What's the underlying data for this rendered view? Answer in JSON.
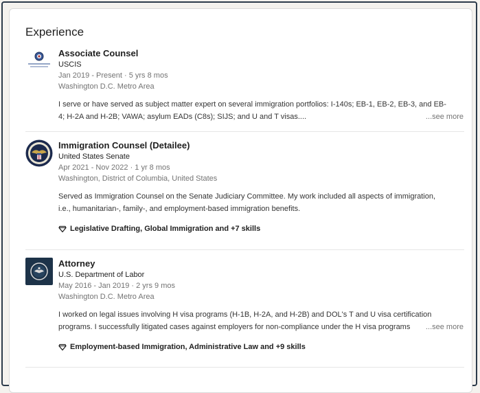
{
  "section": {
    "title": "Experience"
  },
  "experiences": [
    {
      "title": "Associate Counsel",
      "organization": "USCIS",
      "dates": "Jan 2019 - Present · 5 yrs 8 mos",
      "location": "Washington D.C. Metro Area",
      "description_lines": [
        "I serve or have served as subject matter expert on several immigration portfolios: I-140s; EB-1, EB-2, EB-3, and EB-",
        "4; H-2A and H-2B; VAWA; asylum EADs (C8s); SIJS; and U and T visas...."
      ],
      "see_more": "...see more",
      "logo_icon": "uscis-seal-icon"
    },
    {
      "title": "Immigration Counsel (Detailee)",
      "organization": "United States Senate",
      "dates": "Apr 2021 - Nov 2022 · 1 yr 8 mos",
      "location": "Washington, District of Columbia, United States",
      "description_lines": [
        "Served as Immigration Counsel on the Senate Judiciary Committee. My work included all aspects of immigration,",
        "i.e., humanitarian-, family-, and employment-based immigration benefits."
      ],
      "skills": "Legislative Drafting, Global Immigration and +7 skills",
      "logo_icon": "senate-seal-icon"
    },
    {
      "title": "Attorney",
      "organization": "U.S. Department of Labor",
      "dates": "May 2016 - Jan 2019 · 2 yrs 9 mos",
      "location": "Washington D.C. Metro Area",
      "description_lines": [
        "I worked on legal issues involving H visa programs (H-1B, H-2A, and H-2B) and DOL's T and U visa certification",
        "programs. I successfully litigated cases against employers for non-compliance under the H visa programs"
      ],
      "see_more": "...see more",
      "skills": "Employment-based Immigration, Administrative Law and +9 skills",
      "logo_icon": "dol-seal-icon"
    }
  ],
  "colors": {
    "text_primary": "#1f1f1f",
    "text_secondary": "#737373",
    "divider": "#e6e6e6",
    "frame_border": "#2b3a4a"
  }
}
